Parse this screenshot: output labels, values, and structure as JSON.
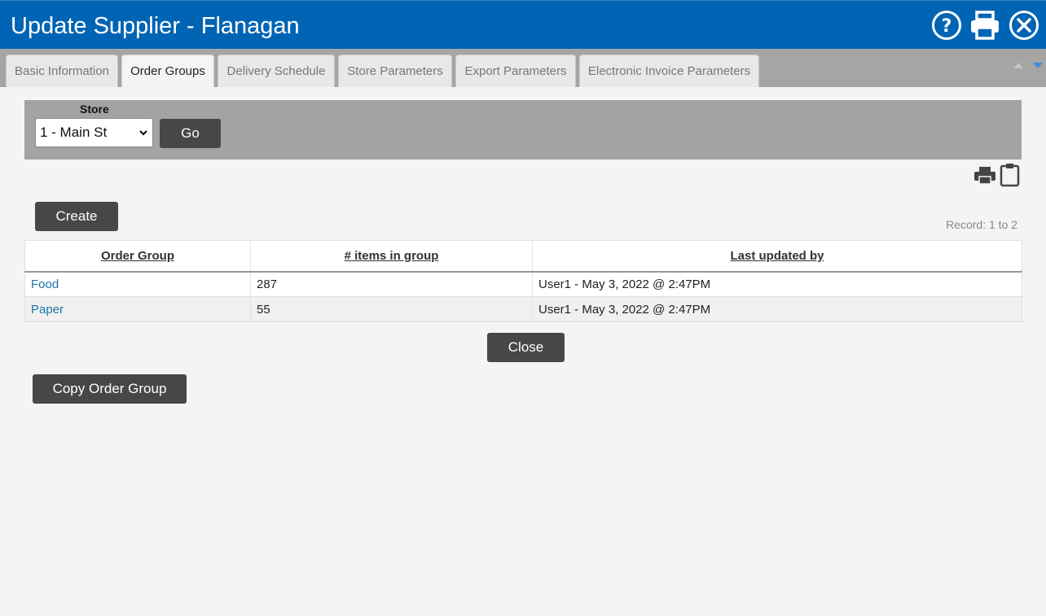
{
  "window": {
    "title": "Update Supplier - Flanagan",
    "icons": [
      "help-icon",
      "print-icon",
      "close-icon"
    ]
  },
  "tabs": [
    {
      "label": "Basic Information",
      "active": false
    },
    {
      "label": "Order Groups",
      "active": true
    },
    {
      "label": "Delivery Schedule",
      "active": false
    },
    {
      "label": "Store Parameters",
      "active": false
    },
    {
      "label": "Export Parameters",
      "active": false
    },
    {
      "label": "Electronic Invoice Parameters",
      "active": false
    }
  ],
  "filter": {
    "store_label": "Store",
    "store_value": "1 - Main St",
    "go_label": "Go"
  },
  "toolbar": {
    "create_label": "Create",
    "record_text": "Record: 1 to 2",
    "icons": [
      "print-icon",
      "clipboard-icon"
    ]
  },
  "table": {
    "headers": [
      "Order Group",
      "# items in group",
      "Last updated by"
    ],
    "rows": [
      {
        "group": "Food",
        "items": "287",
        "updated": "User1 - May 3, 2022 @ 2:47PM"
      },
      {
        "group": "Paper",
        "items": "55",
        "updated": "User1 - May 3, 2022 @ 2:47PM"
      }
    ]
  },
  "actions": {
    "close_label": "Close",
    "copy_label": "Copy Order Group"
  },
  "colors": {
    "titlebar": "#0064b4",
    "tabbar": "#a5a5a5",
    "filter_panel": "#a3a3a3",
    "button": "#474747",
    "link": "#1b76a8"
  }
}
